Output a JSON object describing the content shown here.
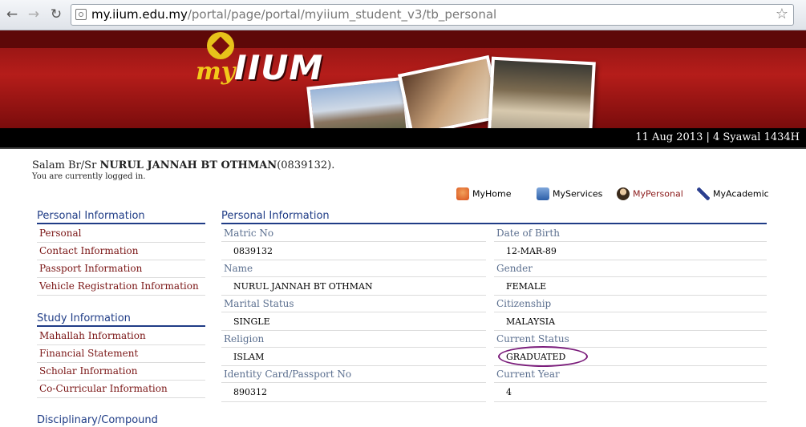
{
  "browser": {
    "url_host": "my.iium.edu.my",
    "url_path": "/portal/page/portal/myiium_student_v3/tb_personal"
  },
  "banner": {
    "logo_my": "my",
    "logo_iium": "IIUM",
    "date": "11 Aug 2013 | 4 Syawal 1434H"
  },
  "greeting": {
    "prefix": "Salam Br/Sr ",
    "name": "NURUL JANNAH BT OTHMAN",
    "id": "(0839132).",
    "logged_in": "You are currently logged in."
  },
  "topnav": [
    {
      "label": "MyHome",
      "icon": "home-icon",
      "color": "#d9531e"
    },
    {
      "label": "MyServices",
      "icon": "monitor-icon",
      "color": "#2c5fa8"
    },
    {
      "label": "MyPersonal",
      "icon": "person-icon",
      "color": "#3a2a1a"
    },
    {
      "label": "MyAcademic",
      "icon": "pen-icon",
      "color": "#2b3f8f"
    }
  ],
  "sidebar": {
    "personal_heading": "Personal Information",
    "personal_items": [
      "Personal",
      "Contact Information",
      "Passport Information",
      "Vehicle Registration Information"
    ],
    "study_heading": "Study Information",
    "study_items": [
      "Mahallah Information",
      "Financial Statement",
      "Scholar Information",
      "Co-Curricular Information"
    ],
    "next_heading": "Disciplinary/Compound"
  },
  "main": {
    "heading": "Personal Information",
    "fields": [
      {
        "label": "Matric No",
        "value": "0839132",
        "label2": "Date of Birth",
        "value2": "12-MAR-89"
      },
      {
        "label": "Name",
        "value": "NURUL JANNAH BT OTHMAN",
        "label2": "Gender",
        "value2": "FEMALE"
      },
      {
        "label": "Marital Status",
        "value": "SINGLE",
        "label2": "Citizenship",
        "value2": "MALAYSIA"
      },
      {
        "label": "Religion",
        "value": "ISLAM",
        "label2": "Current Status",
        "value2": "GRADUATED"
      },
      {
        "label": "Identity Card/Passport No",
        "value": "890312",
        "label2": "Current Year",
        "value2": "4"
      }
    ]
  },
  "colors": {
    "accent_blue": "#1f3c86",
    "link_red": "#7a1515",
    "active_nav": "#8b1a1a",
    "banner_red": "#b51d1a",
    "highlight_circle": "#7b1d7b"
  }
}
